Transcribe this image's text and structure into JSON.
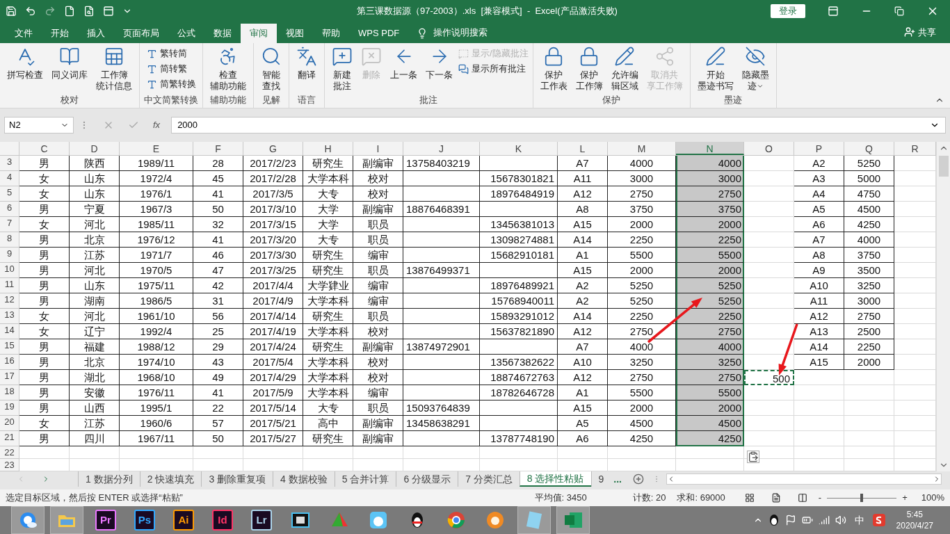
{
  "window": {
    "title": "第三课数据源（97-2003）.xls  [兼容模式]  -  Excel(产品激活失败)",
    "login": "登录"
  },
  "menu": {
    "tabs": [
      {
        "label": "文件",
        "selected": false
      },
      {
        "label": "开始",
        "selected": false
      },
      {
        "label": "插入",
        "selected": false
      },
      {
        "label": "页面布局",
        "selected": false
      },
      {
        "label": "公式",
        "selected": false
      },
      {
        "label": "数据",
        "selected": false
      },
      {
        "label": "审阅",
        "selected": true
      },
      {
        "label": "视图",
        "selected": false
      },
      {
        "label": "帮助",
        "selected": false
      },
      {
        "label": "WPS PDF",
        "selected": false
      }
    ],
    "search": "操作说明搜索",
    "share": "共享"
  },
  "ribbon": {
    "groups": [
      {
        "label": "校对",
        "items": [
          {
            "kind": "large",
            "lines": [
              "拼写检查"
            ],
            "disabled": false
          },
          {
            "kind": "large",
            "lines": [
              "同义词库"
            ],
            "disabled": false
          },
          {
            "kind": "large",
            "lines": [
              "工作簿",
              "统计信息"
            ],
            "disabled": false
          }
        ]
      },
      {
        "label": "中文简繁转换",
        "items": [
          {
            "kind": "small",
            "lines": [
              "繁转简"
            ],
            "disabled": false
          },
          {
            "kind": "small",
            "lines": [
              "简转繁"
            ],
            "disabled": false
          },
          {
            "kind": "small",
            "lines": [
              "简繁转换"
            ],
            "disabled": false
          }
        ]
      },
      {
        "label": "辅助功能",
        "items": [
          {
            "kind": "large",
            "lines": [
              "检查",
              "辅助功能"
            ],
            "disabled": false
          }
        ]
      },
      {
        "label": "见解",
        "items": [
          {
            "kind": "large",
            "lines": [
              "智能",
              "查找"
            ],
            "disabled": false
          }
        ]
      },
      {
        "label": "语言",
        "items": [
          {
            "kind": "large",
            "lines": [
              "翻译"
            ],
            "disabled": false
          }
        ]
      },
      {
        "label": "批注",
        "items": [
          {
            "kind": "large",
            "lines": [
              "新建",
              "批注"
            ],
            "disabled": false
          },
          {
            "kind": "large",
            "lines": [
              "删除"
            ],
            "disabled": true
          },
          {
            "kind": "large",
            "lines": [
              "上一条"
            ],
            "disabled": false
          },
          {
            "kind": "large",
            "lines": [
              "下一条"
            ],
            "disabled": false
          },
          {
            "kind": "small",
            "lines": [
              "显示/隐藏批注"
            ],
            "disabled": true
          },
          {
            "kind": "small",
            "lines": [
              "显示所有批注"
            ],
            "disabled": false
          }
        ]
      },
      {
        "label": "保护",
        "items": [
          {
            "kind": "large",
            "lines": [
              "保护",
              "工作表"
            ],
            "disabled": false
          },
          {
            "kind": "large",
            "lines": [
              "保护",
              "工作簿"
            ],
            "disabled": false
          },
          {
            "kind": "large",
            "lines": [
              "允许编",
              "辑区域"
            ],
            "disabled": false
          },
          {
            "kind": "large",
            "lines": [
              "取消共",
              "享工作簿"
            ],
            "disabled": true
          }
        ]
      },
      {
        "label": "墨迹",
        "items": [
          {
            "kind": "large",
            "lines": [
              "开始",
              "墨迹书写"
            ],
            "disabled": false
          },
          {
            "kind": "large_dropdown",
            "lines": [
              "隐藏墨",
              "迹"
            ],
            "disabled": false
          }
        ]
      }
    ]
  },
  "formula_bar": {
    "name_box": "N2",
    "fx": "fx",
    "value": "2000"
  },
  "sheet": {
    "columns": [
      {
        "label": "C",
        "selected": false
      },
      {
        "label": "D",
        "selected": false
      },
      {
        "label": "E",
        "selected": false
      },
      {
        "label": "F",
        "selected": false
      },
      {
        "label": "G",
        "selected": false
      },
      {
        "label": "H",
        "selected": false
      },
      {
        "label": "I",
        "selected": false
      },
      {
        "label": "J",
        "selected": false
      },
      {
        "label": "K",
        "selected": false
      },
      {
        "label": "L",
        "selected": false
      },
      {
        "label": "M",
        "selected": false
      },
      {
        "label": "N",
        "selected": true
      },
      {
        "label": "O",
        "selected": false
      },
      {
        "label": "P",
        "selected": false
      },
      {
        "label": "Q",
        "selected": false
      },
      {
        "label": "R",
        "selected": false
      }
    ],
    "rows": [
      {
        "row": "3",
        "marquee": false,
        "cells": [
          "男",
          "陕西",
          "1989/11",
          "28",
          "2017/2/23",
          "研究生",
          "副编审",
          "13758403219",
          null,
          "A7",
          "4000",
          "4000",
          null,
          "A2",
          "5250",
          null
        ]
      },
      {
        "row": "4",
        "marquee": false,
        "cells": [
          "女",
          "山东",
          "1972/4",
          "45",
          "2017/2/28",
          "大学本科",
          "校对",
          null,
          "15678301821",
          "A11",
          "3000",
          "3000",
          null,
          "A3",
          "5000",
          null
        ]
      },
      {
        "row": "5",
        "marquee": false,
        "cells": [
          "女",
          "山东",
          "1976/1",
          "41",
          "2017/3/5",
          "大专",
          "校对",
          null,
          "18976484919",
          "A12",
          "2750",
          "2750",
          null,
          "A4",
          "4750",
          null
        ]
      },
      {
        "row": "6",
        "marquee": false,
        "cells": [
          "男",
          "宁夏",
          "1967/3",
          "50",
          "2017/3/10",
          "大学",
          "副编审",
          "18876468391",
          null,
          "A8",
          "3750",
          "3750",
          null,
          "A5",
          "4500",
          null
        ]
      },
      {
        "row": "7",
        "marquee": false,
        "cells": [
          "女",
          "河北",
          "1985/11",
          "32",
          "2017/3/15",
          "大学",
          "职员",
          null,
          "13456381013",
          "A15",
          "2000",
          "2000",
          null,
          "A6",
          "4250",
          null
        ]
      },
      {
        "row": "8",
        "marquee": false,
        "cells": [
          "男",
          "北京",
          "1976/12",
          "41",
          "2017/3/20",
          "大专",
          "职员",
          null,
          "13098274881",
          "A14",
          "2250",
          "2250",
          null,
          "A7",
          "4000",
          null
        ]
      },
      {
        "row": "9",
        "marquee": false,
        "cells": [
          "男",
          "江苏",
          "1971/7",
          "46",
          "2017/3/30",
          "研究生",
          "编审",
          null,
          "15682910181",
          "A1",
          "5500",
          "5500",
          null,
          "A8",
          "3750",
          null
        ]
      },
      {
        "row": "10",
        "marquee": false,
        "cells": [
          "男",
          "河北",
          "1970/5",
          "47",
          "2017/3/25",
          "研究生",
          "职员",
          "13876499371",
          null,
          "A15",
          "2000",
          "2000",
          null,
          "A9",
          "3500",
          null
        ]
      },
      {
        "row": "11",
        "marquee": false,
        "cells": [
          "男",
          "山东",
          "1975/11",
          "42",
          "2017/4/4",
          "大学肄业",
          "编审",
          null,
          "18976489921",
          "A2",
          "5250",
          "5250",
          null,
          "A10",
          "3250",
          null
        ]
      },
      {
        "row": "12",
        "marquee": false,
        "cells": [
          "男",
          "湖南",
          "1986/5",
          "31",
          "2017/4/9",
          "大学本科",
          "编审",
          null,
          "15768940011",
          "A2",
          "5250",
          "5250",
          null,
          "A11",
          "3000",
          null
        ]
      },
      {
        "row": "13",
        "marquee": false,
        "cells": [
          "女",
          "河北",
          "1961/10",
          "56",
          "2017/4/14",
          "研究生",
          "职员",
          null,
          "15893291012",
          "A14",
          "2250",
          "2250",
          null,
          "A12",
          "2750",
          null
        ]
      },
      {
        "row": "14",
        "marquee": false,
        "cells": [
          "女",
          "辽宁",
          "1992/4",
          "25",
          "2017/4/19",
          "大学本科",
          "校对",
          null,
          "15637821890",
          "A12",
          "2750",
          "2750",
          null,
          "A13",
          "2500",
          null
        ]
      },
      {
        "row": "15",
        "marquee": false,
        "cells": [
          "男",
          "福建",
          "1988/12",
          "29",
          "2017/4/24",
          "研究生",
          "副编审",
          "13874972901",
          null,
          "A7",
          "4000",
          "4000",
          null,
          "A14",
          "2250",
          null
        ]
      },
      {
        "row": "16",
        "marquee": false,
        "cells": [
          "男",
          "北京",
          "1974/10",
          "43",
          "2017/5/4",
          "大学本科",
          "校对",
          null,
          "13567382622",
          "A10",
          "3250",
          "3250",
          null,
          "A15",
          "2000",
          null
        ]
      },
      {
        "row": "17",
        "marquee": true,
        "cells": [
          "男",
          "湖北",
          "1968/10",
          "49",
          "2017/4/29",
          "大学本科",
          "校对",
          null,
          "18874672763",
          "A12",
          "2750",
          "2750",
          "500",
          null,
          null,
          null
        ]
      },
      {
        "row": "18",
        "marquee": false,
        "cells": [
          "男",
          "安徽",
          "1976/11",
          "41",
          "2017/5/9",
          "大学本科",
          "编审",
          null,
          "18782646728",
          "A1",
          "5500",
          "5500",
          null,
          null,
          null,
          null
        ]
      },
      {
        "row": "19",
        "marquee": false,
        "cells": [
          "男",
          "山西",
          "1995/1",
          "22",
          "2017/5/14",
          "大专",
          "职员",
          "15093764839",
          null,
          "A15",
          "2000",
          "2000",
          null,
          null,
          null,
          null
        ]
      },
      {
        "row": "20",
        "marquee": false,
        "cells": [
          "女",
          "江苏",
          "1960/6",
          "57",
          "2017/5/21",
          "高中",
          "副编审",
          "13458638291",
          null,
          "A5",
          "4500",
          "4500",
          null,
          null,
          null,
          null
        ]
      },
      {
        "row": "21",
        "marquee": false,
        "cells": [
          "男",
          "四川",
          "1967/11",
          "50",
          "2017/5/27",
          "研究生",
          "副编审",
          null,
          "13787748190",
          "A6",
          "4250",
          "4250",
          null,
          null,
          null,
          null
        ]
      },
      {
        "row": "22",
        "marquee": false
      },
      {
        "row": "23",
        "marquee": false
      }
    ]
  },
  "sheet_tabs": {
    "tabs": [
      {
        "label": "1 数据分列",
        "selected": false
      },
      {
        "label": "2 快速填充",
        "selected": false
      },
      {
        "label": "3 删除重复项",
        "selected": false
      },
      {
        "label": "4 数据校验",
        "selected": false
      },
      {
        "label": "5 合并计算",
        "selected": false
      },
      {
        "label": "6 分级显示",
        "selected": false
      },
      {
        "label": "7 分类汇总",
        "selected": false
      },
      {
        "label": "8 选择性粘贴",
        "selected": true
      },
      {
        "label": "9",
        "selected": false
      }
    ],
    "more": "..."
  },
  "status_bar": {
    "message": "选定目标区域，然后按 ENTER 或选择“粘贴”",
    "stats": [
      "平均值: 3450",
      "计数: 20",
      "求和: 69000"
    ],
    "zoom_out": "-",
    "zoom_in": "+",
    "zoom": {
      "level": 0.5
    },
    "zoom_text": "100%"
  },
  "taskbar": {
    "apps": [
      {
        "kind": "icon",
        "active": true
      },
      {
        "kind": "icon",
        "active": true
      },
      {
        "kind": "letters",
        "label": "Pr",
        "color": "#ea77ff",
        "active": false
      },
      {
        "kind": "letters",
        "label": "Ps",
        "color": "#31a8ff",
        "active": false
      },
      {
        "kind": "letters",
        "label": "Ai",
        "color": "#ff9a00",
        "active": false
      },
      {
        "kind": "letters",
        "label": "Id",
        "color": "#ff3366",
        "active": false
      },
      {
        "kind": "letters",
        "label": "Lr",
        "color": "#add5ec",
        "active": false
      },
      {
        "kind": "icon",
        "active": false
      },
      {
        "kind": "icon",
        "active": false
      },
      {
        "kind": "icon",
        "active": false
      },
      {
        "kind": "icon",
        "active": false
      },
      {
        "kind": "icon",
        "active": false
      },
      {
        "kind": "icon",
        "active": false
      },
      {
        "kind": "icon",
        "active": true
      },
      {
        "kind": "icon",
        "active": true
      }
    ],
    "ime": "中",
    "time": "5:45",
    "date": "2020/4/27"
  }
}
